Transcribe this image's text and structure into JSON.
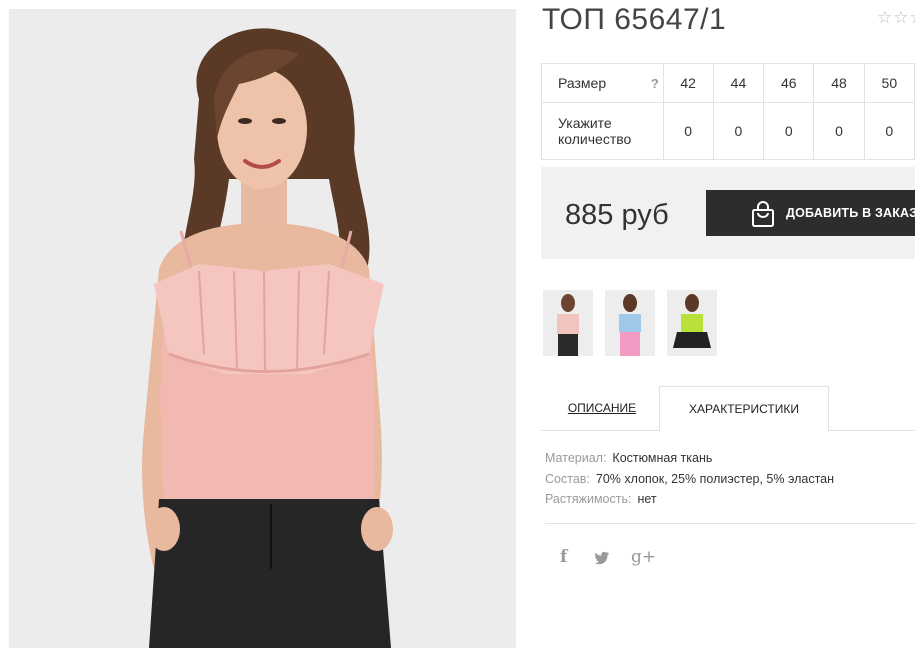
{
  "product": {
    "title": "ТОП 65647/1",
    "rating_stars": "☆☆☆",
    "price": "885 руб",
    "add_to_order_label": "ДОБАВИТЬ В ЗАКАЗ"
  },
  "size_table": {
    "size_label": "Размер",
    "help_mark": "?",
    "sizes": [
      "42",
      "44",
      "46",
      "48",
      "50"
    ],
    "qty_label_line1": "Укажите",
    "qty_label_line2": "количество",
    "quantities": [
      "0",
      "0",
      "0",
      "0",
      "0"
    ]
  },
  "thumbnails": [
    {
      "name": "pink-top-thumbnail",
      "color": "#f3c3c0"
    },
    {
      "name": "blue-top-thumbnail",
      "color": "#9ec9ea"
    },
    {
      "name": "green-top-thumbnail",
      "color": "#b8e23a"
    }
  ],
  "tabs": {
    "description": "ОПИСАНИЕ",
    "characteristics": "ХАРАКТЕРИСТИКИ",
    "active": "characteristics"
  },
  "characteristics": [
    {
      "key": "Материал:",
      "value": "Костюмная ткань"
    },
    {
      "key": "Состав:",
      "value": "70% хлопок, 25% полиэстер, 5% эластан"
    },
    {
      "key": "Растяжимость:",
      "value": "нет"
    }
  ],
  "social": {
    "facebook": "f",
    "twitter": "twitter-icon",
    "googleplus": "g+"
  },
  "colors": {
    "top_pink": "#f2b9b3",
    "button_dark": "#2d2d2d",
    "buybox_bg": "#f1f1f1"
  }
}
